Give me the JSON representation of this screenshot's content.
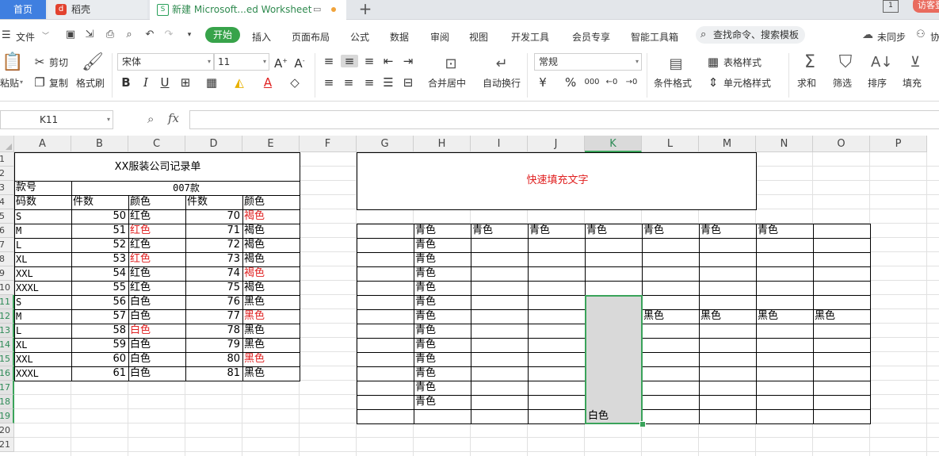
{
  "tabs": {
    "home": "首页",
    "daoke": "稻壳",
    "workbook": "新建 Microsoft...ed Worksheet",
    "plus": "+"
  },
  "titlebar": {
    "window_box": "1",
    "visitor": "访客登"
  },
  "menu": {
    "file": "文件",
    "items": [
      "开始",
      "插入",
      "页面布局",
      "公式",
      "数据",
      "审阅",
      "视图",
      "开发工具",
      "会员专享",
      "智能工具箱"
    ],
    "search": "查找命令、搜索模板",
    "sync": "未同步",
    "collab": "协"
  },
  "ribbon": {
    "paste": "粘贴",
    "cut": "剪切",
    "copy": "复制",
    "format_painter": "格式刷",
    "font_name": "宋体",
    "font_size": "11",
    "bold": "B",
    "italic": "I",
    "underline": "U",
    "merge_center": "合并居中",
    "wrap_text": "自动换行",
    "number_format": "常规",
    "currency": "¥",
    "percent": "%",
    "thousands": "000",
    "cond_format": "条件格式",
    "table_style": "表格样式",
    "cell_style": "单元格样式",
    "sum": "求和",
    "filter": "筛选",
    "sort": "排序",
    "fill": "填充"
  },
  "formula_bar": {
    "name_box": "K11",
    "fx": "fx",
    "content": ""
  },
  "columns": [
    "A",
    "B",
    "C",
    "D",
    "E",
    "F",
    "G",
    "H",
    "I",
    "J",
    "K",
    "L",
    "M",
    "N",
    "O",
    "P"
  ],
  "active_column": "K",
  "rows": [
    "1",
    "2",
    "3",
    "4",
    "5",
    "6",
    "7",
    "8",
    "9",
    "10",
    "11",
    "12",
    "13",
    "14",
    "15",
    "16",
    "17",
    "18",
    "19",
    "20",
    "21"
  ],
  "colors": {
    "accent": "#37a34a",
    "home_tab": "#3f7fe0",
    "red_text": "#e02020",
    "selection": "#3aa35a"
  },
  "table1": {
    "title": "XX服装公司记录单",
    "style_label": "款号",
    "style_value": "007款",
    "headers": [
      "码数",
      "件数",
      "颜色",
      "件数",
      "颜色"
    ],
    "rows": [
      [
        "S",
        "50",
        "红色",
        "70",
        "褐色"
      ],
      [
        "M",
        "51",
        "红色",
        "71",
        "褐色"
      ],
      [
        "L",
        "52",
        "红色",
        "72",
        "褐色"
      ],
      [
        "XL",
        "53",
        "红色",
        "73",
        "褐色"
      ],
      [
        "XXL",
        "54",
        "红色",
        "74",
        "褐色"
      ],
      [
        "XXXL",
        "55",
        "红色",
        "75",
        "褐色"
      ],
      [
        "S",
        "56",
        "白色",
        "76",
        "黑色"
      ],
      [
        "M",
        "57",
        "白色",
        "77",
        "黑色"
      ],
      [
        "L",
        "58",
        "白色",
        "78",
        "黑色"
      ],
      [
        "XL",
        "59",
        "白色",
        "79",
        "黑色"
      ],
      [
        "XXL",
        "60",
        "白色",
        "80",
        "黑色"
      ],
      [
        "XXXL",
        "61",
        "白色",
        "81",
        "黑色"
      ]
    ],
    "red_cells": [
      [
        0,
        4
      ],
      [
        1,
        2
      ],
      [
        3,
        2
      ],
      [
        4,
        4
      ],
      [
        7,
        4
      ],
      [
        8,
        2
      ],
      [
        10,
        4
      ]
    ]
  },
  "table2": {
    "title": "快速填充文字",
    "top_row": [
      "青色",
      "青色",
      "青色",
      "青色",
      "青色",
      "青色",
      "青色"
    ],
    "h_column": [
      "青色",
      "青色",
      "青色",
      "青色",
      "青色",
      "青色",
      "青色",
      "青色",
      "青色",
      "青色",
      "青色",
      "青色"
    ],
    "black_row": [
      "黑色",
      "黑色",
      "黑色",
      "黑色"
    ],
    "white_cell": "白色"
  }
}
